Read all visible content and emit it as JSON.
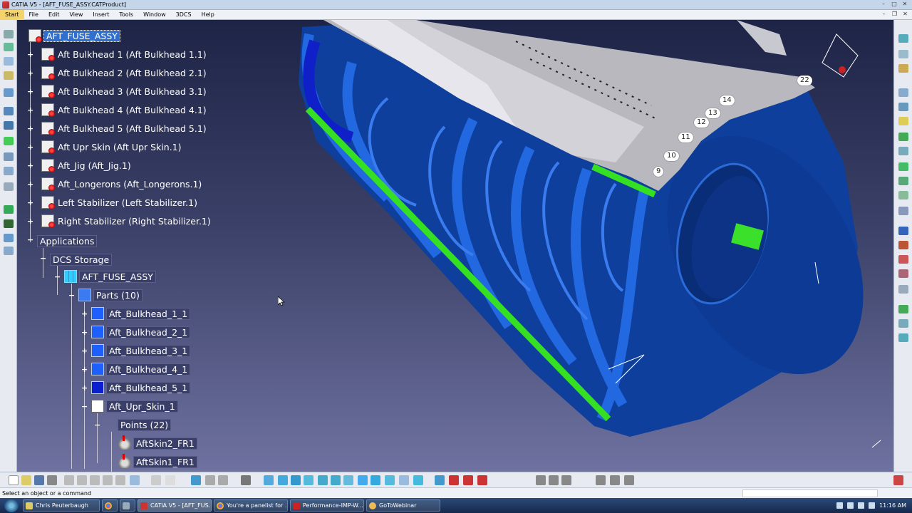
{
  "window": {
    "title": "CATIA V5 - [AFT_FUSE_ASSY.CATProduct]"
  },
  "menu": {
    "items": [
      "Start",
      "File",
      "Edit",
      "View",
      "Insert",
      "Tools",
      "Window",
      "3DCS",
      "Help"
    ]
  },
  "tree": {
    "root": "AFT_FUSE_ASSY",
    "children": [
      "Aft Bulkhead 1 (Aft Bulkhead 1.1)",
      "Aft Bulkhead 2 (Aft Bulkhead 2.1)",
      "Aft Bulkhead 3 (Aft Bulkhead 3.1)",
      "Aft Bulkhead 4 (Aft Bulkhead 4.1)",
      "Aft Bulkhead 5 (Aft Bulkhead 5.1)",
      "Aft Upr Skin (Aft Upr Skin.1)",
      "Aft_Jig (Aft_Jig.1)",
      "Aft_Longerons (Aft_Longerons.1)",
      "Left Stabilizer (Left Stabilizer.1)",
      "Right Stabilizer (Right Stabilizer.1)"
    ],
    "applications": "Applications",
    "dcs_storage": "DCS Storage",
    "dcs_assy": "AFT_FUSE_ASSY",
    "parts_group": "Parts (10)",
    "parts": [
      "Aft_Bulkhead_1_1",
      "Aft_Bulkhead_2_1",
      "Aft_Bulkhead_3_1",
      "Aft_Bulkhead_4_1",
      "Aft_Bulkhead_5_1",
      "Aft_Upr_Skin_1"
    ],
    "points_group": "Points (22)",
    "points": [
      "AftSkin2_FR1",
      "AftSkin1_FR1"
    ]
  },
  "callouts": [
    "22",
    "14",
    "13",
    "12",
    "11",
    "10",
    "9"
  ],
  "status": {
    "prompt": "Select an object or a command"
  },
  "taskbar": {
    "items": [
      "Chris Peuterbaugh",
      "CATIA V5 - [AFT_FUS...",
      "You're a panelist for ...",
      "Performance-IMP-W...",
      "GoToWebinar"
    ],
    "clock": "11:16 AM"
  },
  "colors": {
    "viewport_top": "#1e2446",
    "viewport_bottom": "#6f72a0",
    "bulkhead_blue": "#0e3f9c",
    "longeron_green": "#35e022",
    "skin_grey": "#b8b8be",
    "selection": "#2f6fd0"
  }
}
